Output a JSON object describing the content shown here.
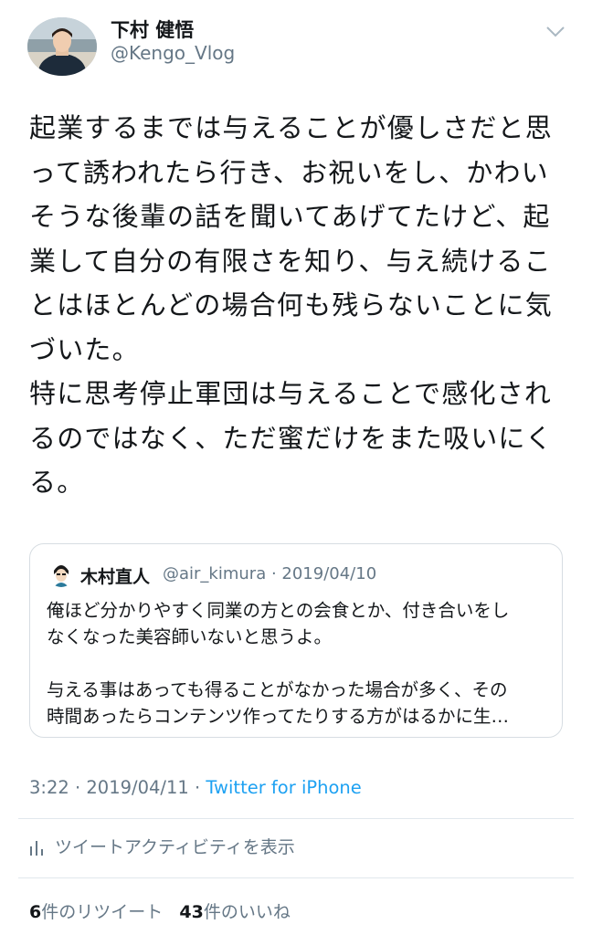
{
  "author": {
    "name": "下村 健悟",
    "handle": "@Kengo_Vlog"
  },
  "tweet": {
    "lines": [
      "起業するまでは与えることが優しさだと思",
      "って誘われたら行き、お祝いをし、かわい",
      "そうな後輩の話を聞いてあげてたけど、起",
      "業して自分の有限さを知り、与え続けるこ",
      "とはほとんどの場合何も残らないことに気",
      "づいた。",
      "特に思考停止軍団は与えることで感化され",
      "るのではなく、ただ蜜だけをまた吸いにく",
      "る。"
    ]
  },
  "quote": {
    "name": "木村直人",
    "handle_date": "@air_kimura · 2019/04/10",
    "lines": [
      "俺ほど分かりやすく同業の方との会食とか、付き合いをし",
      "なくなった美容師いないと思うよ。",
      "",
      "与える事はあっても得ることがなかった場合が多く、その",
      "時間あったらコンテンツ作ってたりする方がはるかに生…"
    ]
  },
  "meta": {
    "time_date": "3:22 · 2019/04/11 · ",
    "source": "Twitter for iPhone"
  },
  "activity": {
    "label": "ツイートアクティビティを表示",
    "icon": "bar-chart-icon"
  },
  "stats": {
    "retweets_count": "6",
    "retweets_label": "件のリツイート",
    "likes_count": "43",
    "likes_label": "件のいいね"
  },
  "colors": {
    "secondary": "#657786",
    "link": "#1da1f2",
    "border": "#d7dde2"
  }
}
